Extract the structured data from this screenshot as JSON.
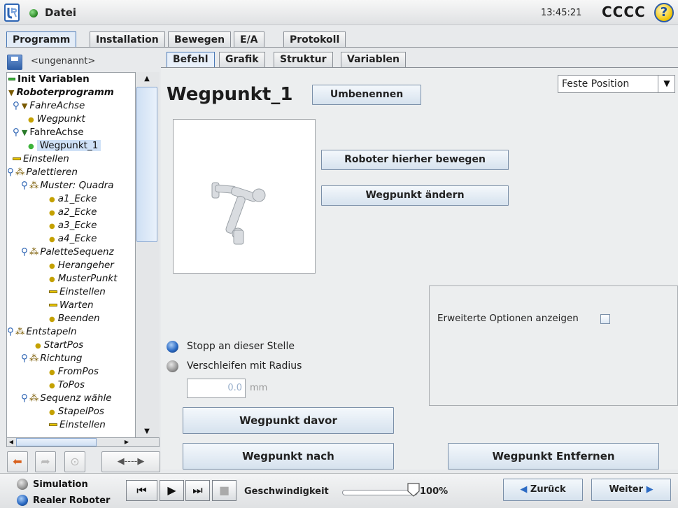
{
  "topbar": {
    "file_label": "Datei",
    "clock": "13:45:21",
    "robot_name": "CCCC",
    "help_symbol": "?"
  },
  "main_tabs": [
    "Programm",
    "Installation",
    "Bewegen",
    "E/A",
    "Protokoll"
  ],
  "sidebar": {
    "program_name": "<ungenannt>",
    "tree": [
      {
        "label": "Init Variablen",
        "icon": "dash-green"
      },
      {
        "label": "Roboterprogramm",
        "icon": "triangle-down"
      },
      {
        "label": "FahreAchse",
        "icon": "triangle-down"
      },
      {
        "label": "Wegpunkt",
        "icon": "dot"
      },
      {
        "label": "FahreAchse",
        "icon": "triangle-down"
      },
      {
        "label": "Wegpunkt_1",
        "icon": "dot"
      },
      {
        "label": "Einstellen",
        "icon": "dash-yellow"
      },
      {
        "label": "Palettieren",
        "icon": "cluster"
      },
      {
        "label": "Muster: Quadra",
        "icon": "cluster"
      },
      {
        "label": "a1_Ecke",
        "icon": "dot"
      },
      {
        "label": "a2_Ecke",
        "icon": "dot"
      },
      {
        "label": "a3_Ecke",
        "icon": "dot"
      },
      {
        "label": "a4_Ecke",
        "icon": "dot"
      },
      {
        "label": "PaletteSequenz",
        "icon": "cluster"
      },
      {
        "label": "Herangeher",
        "icon": "dot"
      },
      {
        "label": "MusterPunkt",
        "icon": "dot"
      },
      {
        "label": "Einstellen",
        "icon": "dash-yellow"
      },
      {
        "label": "Warten",
        "icon": "dash-yellow"
      },
      {
        "label": "Beenden",
        "icon": "dot"
      },
      {
        "label": "Entstapeln",
        "icon": "cluster"
      },
      {
        "label": "StartPos",
        "icon": "dot"
      },
      {
        "label": "Richtung",
        "icon": "cluster"
      },
      {
        "label": "FromPos",
        "icon": "dot"
      },
      {
        "label": "ToPos",
        "icon": "dot"
      },
      {
        "label": "Sequenz wähle",
        "icon": "cluster"
      },
      {
        "label": "StapelPos",
        "icon": "dot"
      },
      {
        "label": "Einstellen",
        "icon": "dash-yellow"
      }
    ]
  },
  "sub_tabs": [
    "Befehl",
    "Grafik",
    "Struktur",
    "Variablen"
  ],
  "waypoint": {
    "title": "Wegpunkt_1",
    "rename_button": "Umbenennen",
    "position_type": "Feste Position",
    "move_here_button": "Roboter hierher bewegen",
    "change_button": "Wegpunkt ändern",
    "extended_options_label": "Erweiterte Optionen anzeigen",
    "stop_option": "Stopp an dieser Stelle",
    "blend_option": "Verschleifen mit Radius",
    "radius_value": "0.0",
    "radius_unit": "mm",
    "before_button": "Wegpunkt davor",
    "after_button": "Wegpunkt nach",
    "remove_button": "Wegpunkt Entfernen"
  },
  "bottombar": {
    "simulation_label": "Simulation",
    "real_robot_label": "Realer Roboter",
    "speed_label": "Geschwindigkeit",
    "speed_value": "100%",
    "back_button": "Zurück",
    "next_button": "Weiter"
  },
  "colors": {
    "accent_blue": "#2c6bc4",
    "status_green": "#2c8a27",
    "button_gradient_top": "#f4f8fc",
    "button_gradient_bottom": "#d6e2ee"
  }
}
